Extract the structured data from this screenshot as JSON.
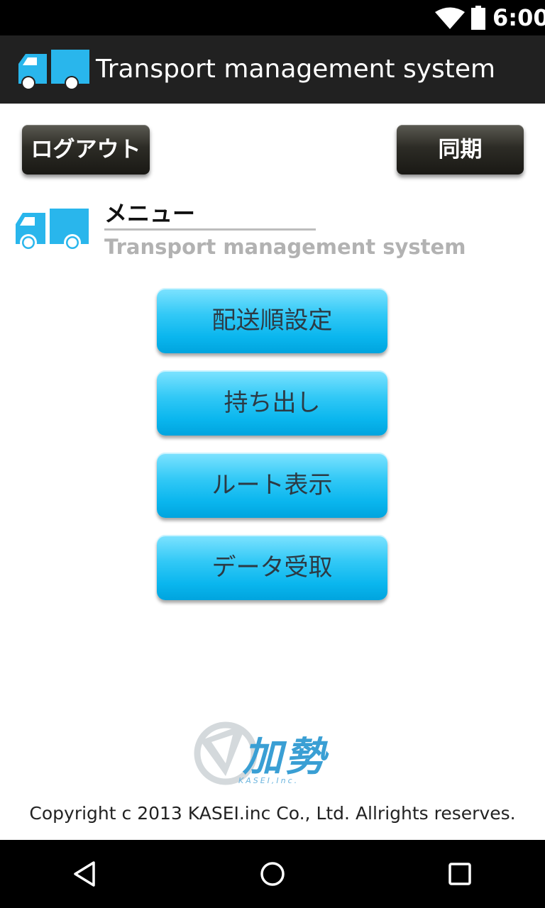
{
  "status_bar": {
    "time": "6:00",
    "icons": [
      "wifi-icon",
      "battery-icon"
    ]
  },
  "app_bar": {
    "title": "Transport management system",
    "logo_icon": "truck-icon"
  },
  "toolbar": {
    "logout_label": "ログアウト",
    "sync_label": "同期"
  },
  "header": {
    "title": "メニュー",
    "subtitle": "Transport management system"
  },
  "menu": {
    "items": [
      {
        "label": "配送順設定"
      },
      {
        "label": "持ち出し"
      },
      {
        "label": "ルート表示"
      },
      {
        "label": "データ受取"
      }
    ]
  },
  "footer": {
    "company_logo_text": "加勢",
    "company_logo_sub": "KASEI,Inc.",
    "copyright": "Copyright c 2013 KASEI.inc Co., Ltd. Allrights reserves."
  },
  "nav_bar": {
    "icons": [
      "back-icon",
      "home-icon",
      "recents-icon"
    ]
  },
  "colors": {
    "accent_blue": "#1fb4ea",
    "app_bar_bg": "#212121",
    "subtitle_gray": "#b2b2b2"
  }
}
